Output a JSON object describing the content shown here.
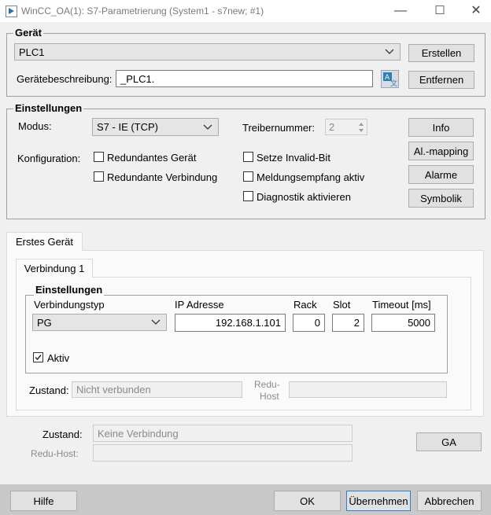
{
  "window": {
    "title": "WinCC_OA(1): S7-Parametrierung (System1 - s7new; #1)",
    "controls": {
      "minimize": "—",
      "maximize": "☐",
      "close": "✕"
    }
  },
  "geraet": {
    "group_title": "Gerät",
    "device_value": "PLC1",
    "description_label": "Gerätebeschreibung:",
    "description_value": "_PLC1.",
    "create_button": "Erstellen",
    "remove_button": "Entfernen"
  },
  "einstellungen": {
    "group_title": "Einstellungen",
    "modus_label": "Modus:",
    "modus_value": "S7 - IE (TCP)",
    "treiber_label": "Treibernummer:",
    "treiber_value": "2",
    "konfig_label": "Konfiguration:",
    "checkboxes": [
      {
        "label": "Redundantes Gerät",
        "checked": false
      },
      {
        "label": "Redundante Verbindung",
        "checked": false
      },
      {
        "label": "Setze Invalid-Bit",
        "checked": false
      },
      {
        "label": "Meldungsempfang aktiv",
        "checked": false
      },
      {
        "label": "Diagnostik aktivieren",
        "checked": false
      }
    ],
    "buttons": {
      "info": "Info",
      "mapping": "Al.-mapping",
      "alarme": "Alarme",
      "symbolik": "Symbolik"
    }
  },
  "device_tab": {
    "label": "Erstes Gerät"
  },
  "connection": {
    "tab_label": "Verbindung 1",
    "group_title": "Einstellungen",
    "typ_header": "Verbindungstyp",
    "ip_header": "IP Adresse",
    "rack_header": "Rack",
    "slot_header": "Slot",
    "timeout_header": "Timeout [ms]",
    "typ_value": "PG",
    "ip_value": "192.168.1.101",
    "rack_value": "0",
    "slot_value": "2",
    "timeout_value": "5000",
    "aktiv_label": "Aktiv",
    "aktiv_checked": true,
    "zustand_label": "Zustand:",
    "zustand_value": "Nicht verbunden",
    "redu_host_label_1": "Redu-",
    "redu_host_label_2": "Host",
    "redu_host_value": ""
  },
  "device_status": {
    "zustand_label": "Zustand:",
    "zustand_value": "Keine Verbindung",
    "redu_host_label": "Redu-Host:",
    "redu_host_value": "",
    "ga_button": "GA"
  },
  "footer": {
    "help_button": "Hilfe",
    "ok_button": "OK",
    "apply_button": "Übernehmen",
    "cancel_button": "Abbrechen"
  }
}
